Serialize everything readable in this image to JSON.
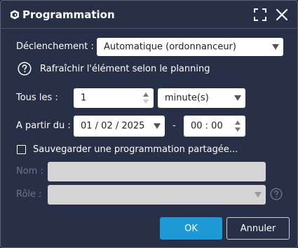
{
  "window": {
    "title": "Programmation",
    "icons": {
      "app": "app-logo-icon",
      "maximize": "maximize-icon",
      "close": "close-icon"
    }
  },
  "trigger": {
    "label": "Déclenchement :",
    "value": "Automatique (ordonnanceur)"
  },
  "refresh_hint": {
    "icon": "help-icon",
    "text": "Rafraîchir l'élément selon le planning"
  },
  "every": {
    "label": "Tous les :",
    "value": "1",
    "unit": "minute(s)"
  },
  "start": {
    "label": "A partir du :",
    "date": "01 / 02 / 2025",
    "separator": "-",
    "time": "00 : 00"
  },
  "shared": {
    "checkbox_label": "Sauvegarder une programmation partagée...",
    "checked": false
  },
  "name": {
    "label": "Nom :",
    "value": ""
  },
  "role": {
    "label": "Rôle :",
    "value": ""
  },
  "buttons": {
    "ok": "OK",
    "cancel": "Annuler"
  },
  "colors": {
    "background": "#273046",
    "accent": "#1d9ad6",
    "disabled_text": "#6d7586"
  }
}
